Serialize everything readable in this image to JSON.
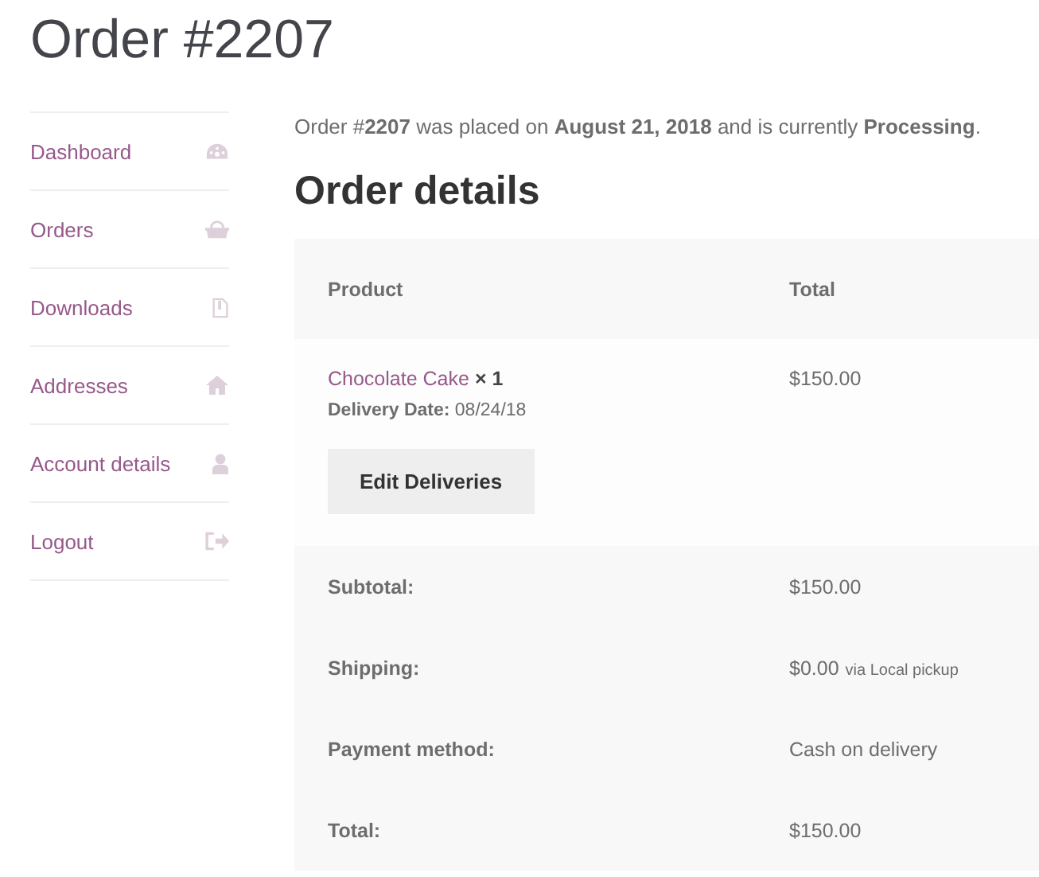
{
  "page_title": "Order #2207",
  "sidebar": {
    "items": [
      {
        "label": "Dashboard"
      },
      {
        "label": "Orders"
      },
      {
        "label": "Downloads"
      },
      {
        "label": "Addresses"
      },
      {
        "label": "Account details"
      },
      {
        "label": "Logout"
      }
    ]
  },
  "intro": "Order #**2207** was placed on **August 21, 2018** and is currently **Processing**.",
  "section_title": "Order details",
  "table": {
    "columns": [
      "Product",
      "Total"
    ],
    "item": {
      "name": "Chocolate Cake",
      "quantity": "× 1",
      "meta": "**Delivery Date:** 08/24/18",
      "button": "Edit Deliveries",
      "total": "$150.00"
    },
    "totals": [
      {
        "label": "Subtotal:",
        "value": "$150.00"
      },
      {
        "label": "Shipping:",
        "value": "$0.00",
        "note": "via Local pickup"
      },
      {
        "label": "Payment method:",
        "value": "Cash on delivery"
      },
      {
        "label": "Total:",
        "value": "$150.00"
      }
    ]
  }
}
